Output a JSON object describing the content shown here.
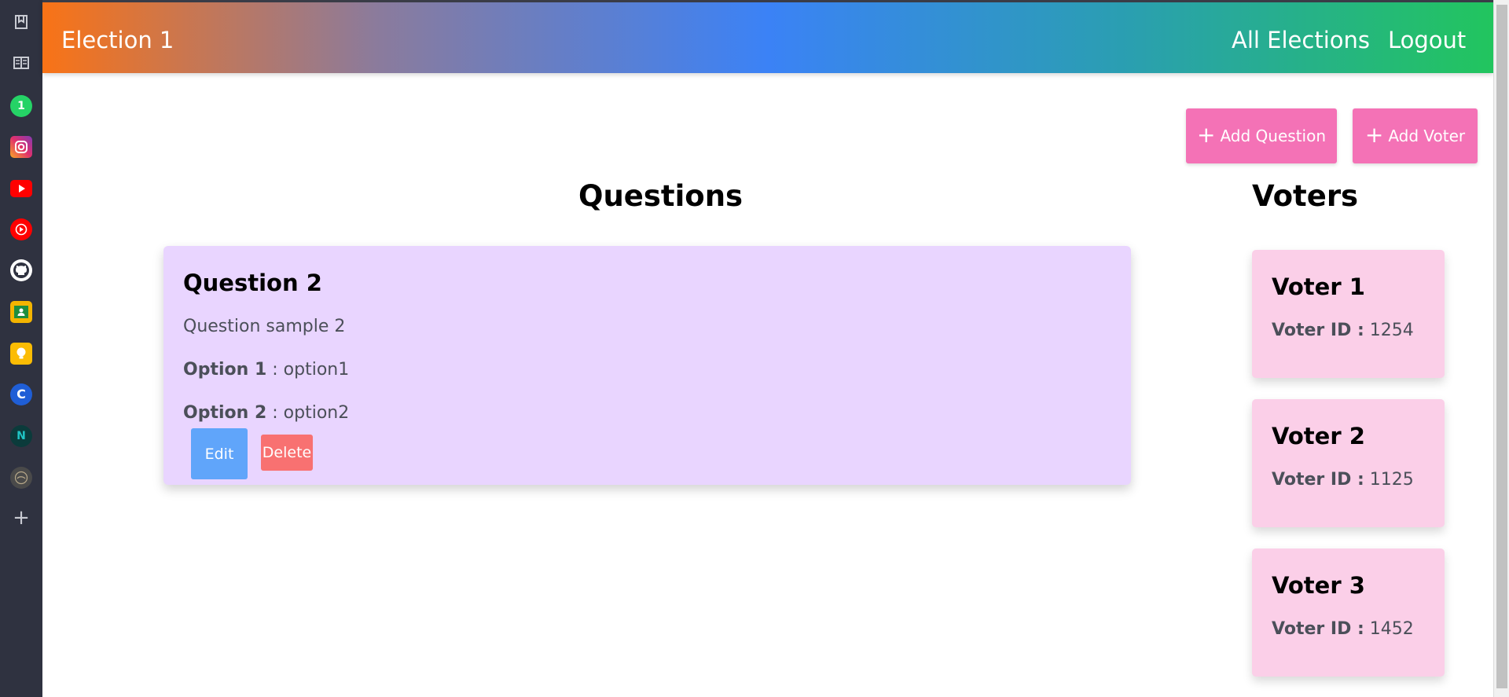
{
  "sidebar": {
    "icons": [
      {
        "name": "bookmark-icon",
        "glyph": "⎙",
        "color": "#2f3240"
      },
      {
        "name": "reading-list-icon",
        "glyph": "▤",
        "color": "#2f3240"
      },
      {
        "name": "whatsapp-icon",
        "glyph": "1",
        "color": "#25d366"
      },
      {
        "name": "instagram-icon",
        "glyph": "◎",
        "color": "#e1306c"
      },
      {
        "name": "youtube-icon",
        "glyph": "▶",
        "color": "#ff0000"
      },
      {
        "name": "youtube-music-icon",
        "glyph": "▶",
        "color": "#ff0000"
      },
      {
        "name": "github-icon",
        "glyph": "●",
        "color": "#ffffff"
      },
      {
        "name": "google-classroom-icon",
        "glyph": "▦",
        "color": "#f4b400"
      },
      {
        "name": "keep-icon",
        "glyph": "●",
        "color": "#fbbc04"
      },
      {
        "name": "c-app-icon",
        "glyph": "C",
        "color": "#1f5ed6"
      },
      {
        "name": "n-app-icon",
        "glyph": "N",
        "color": "#0b3b3b"
      },
      {
        "name": "round-app-icon",
        "glyph": "◉",
        "color": "#4a4a4a"
      },
      {
        "name": "add-icon",
        "glyph": "+",
        "color": "#2f3240"
      }
    ]
  },
  "nav": {
    "brand": "Election 1",
    "links": [
      "All Elections",
      "Logout"
    ]
  },
  "actions": {
    "add_question": "Add Question",
    "add_voter": "Add Voter",
    "plus": "+"
  },
  "questions_section": {
    "heading": "Questions",
    "items": [
      {
        "title": "Question 2",
        "description": "Question sample 2",
        "options": [
          {
            "label": "Option 1",
            "sep": " : ",
            "value": "option1"
          },
          {
            "label": "Option 2",
            "sep": " : ",
            "value": "option2"
          }
        ],
        "edit_label": "Edit",
        "delete_label": "Delete"
      }
    ]
  },
  "voters_section": {
    "heading": "Voters",
    "id_label": "Voter ID :",
    "items": [
      {
        "name": "Voter 1",
        "id": "1254"
      },
      {
        "name": "Voter 2",
        "id": "1125"
      },
      {
        "name": "Voter 3",
        "id": "1452"
      }
    ]
  },
  "colors": {
    "question_card": "#e9d5ff",
    "voter_card": "#fbcfe8",
    "action_button": "#f472b6",
    "edit_button": "#60a5fa",
    "delete_button": "#f87171"
  }
}
